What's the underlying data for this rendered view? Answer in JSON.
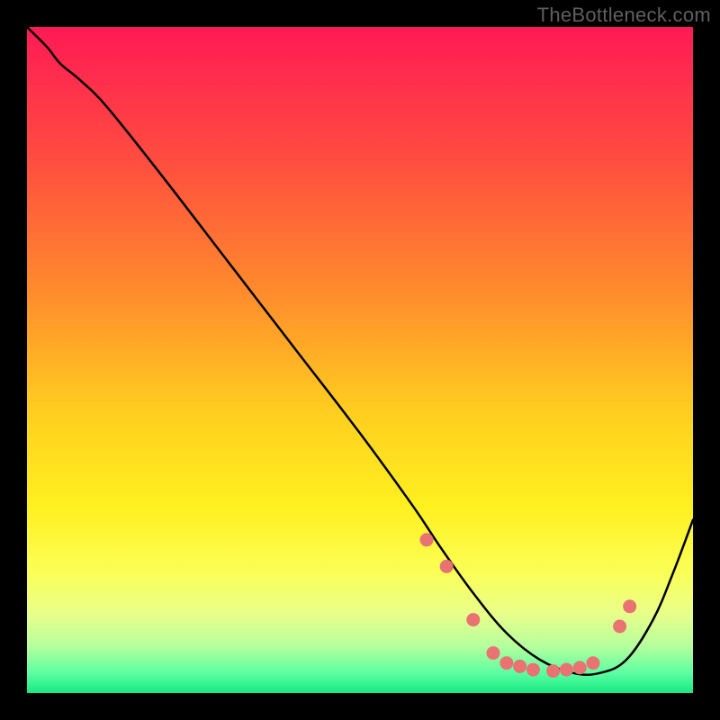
{
  "watermark": "TheBottleneck.com",
  "colors": {
    "dot": "#e87372",
    "curve": "#000000",
    "frame_bg": "#000000"
  },
  "gradient_stops": [
    {
      "offset": 0.0,
      "color": "#ff1a55"
    },
    {
      "offset": 0.2,
      "color": "#ff4d3f"
    },
    {
      "offset": 0.4,
      "color": "#ff8c2c"
    },
    {
      "offset": 0.58,
      "color": "#ffcf1f"
    },
    {
      "offset": 0.72,
      "color": "#fff020"
    },
    {
      "offset": 0.82,
      "color": "#faff57"
    },
    {
      "offset": 0.88,
      "color": "#e9ff8a"
    },
    {
      "offset": 0.93,
      "color": "#b6ff9d"
    },
    {
      "offset": 0.97,
      "color": "#5cffa2"
    },
    {
      "offset": 1.0,
      "color": "#18e884"
    }
  ],
  "chart_data": {
    "type": "line",
    "title": "",
    "xlabel": "",
    "ylabel": "",
    "xlim": [
      0,
      100
    ],
    "ylim": [
      0,
      100
    ],
    "note": "No axes or tick labels are rendered; values are estimated from pixel positions on a 0–100 normalized scale.",
    "series": [
      {
        "name": "curve",
        "x": [
          0,
          3,
          5,
          8,
          12,
          20,
          30,
          40,
          50,
          58,
          62,
          67,
          72,
          77,
          82,
          86,
          90,
          94,
          97,
          100
        ],
        "y": [
          100,
          97,
          94.5,
          92,
          88,
          78,
          65,
          52,
          39,
          28,
          22,
          15,
          9,
          5,
          3,
          3,
          5,
          11,
          18,
          26
        ]
      }
    ],
    "points": {
      "name": "dots",
      "x": [
        60,
        63,
        67,
        70,
        72,
        74,
        76,
        79,
        81,
        83,
        85,
        89,
        90.5
      ],
      "y": [
        23,
        19,
        11,
        6,
        4.5,
        4,
        3.5,
        3.3,
        3.5,
        3.8,
        4.5,
        10,
        13
      ]
    }
  }
}
